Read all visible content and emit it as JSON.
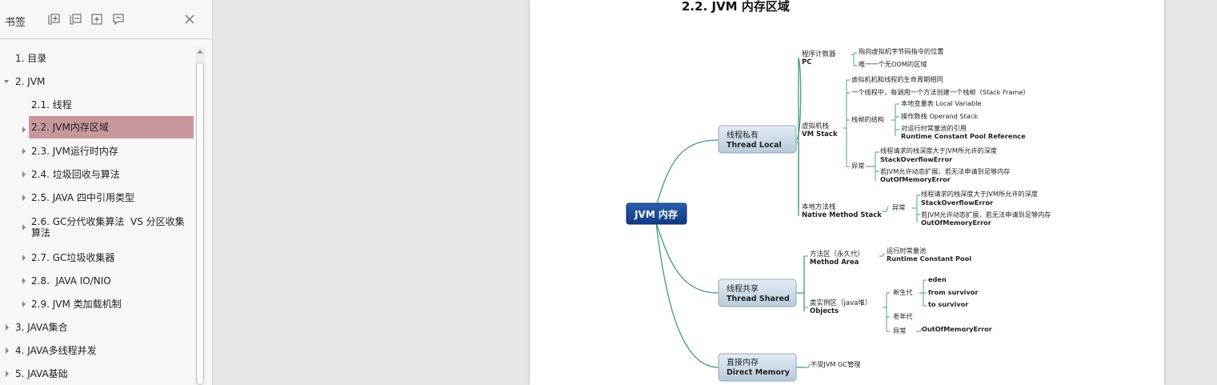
{
  "sidebar": {
    "title": "书签",
    "items": [
      {
        "label": "1. 目录"
      },
      {
        "label": "2. JVM"
      },
      {
        "label": "2.1. 线程"
      },
      {
        "label": "2.2. JVM内存区域"
      },
      {
        "label": "2.3. JVM运行时内存"
      },
      {
        "label": "2.4. 垃圾回收与算法"
      },
      {
        "label": "2.5. JAVA 四中引用类型"
      },
      {
        "label": "2.6. GC分代收集算法  VS 分区收集",
        "label2": "算法"
      },
      {
        "label": "2.7. GC垃圾收集器"
      },
      {
        "label": "2.8.  JAVA IO/NIO"
      },
      {
        "label": "2.9. JVM 类加载机制"
      },
      {
        "label": "3. JAVA集合"
      },
      {
        "label": "4. JAVA多线程并发"
      },
      {
        "label": "5. JAVA基础"
      }
    ]
  },
  "page": {
    "heading": "2.2. JVM 内存区域"
  },
  "mindmap": {
    "root": "JVM 内存",
    "b1": {
      "cn": "线程私有",
      "en": "Thread Local"
    },
    "b2": {
      "cn": "线程共享",
      "en": "Thread Shared"
    },
    "b3": {
      "cn": "直接内存",
      "en": "Direct Memory"
    },
    "pc": {
      "cn": "程序计数器",
      "en": "PC",
      "c1": "指向虚拟机字节码指令的位置",
      "c2": "唯一一个无OOM的区域"
    },
    "vms": {
      "cn": "虚拟机栈",
      "en": "VM Stack",
      "c1": "虚拟机机和线程的生命周期相同",
      "c2": "一个线程中，每调用一个方法创建一个栈帧（Stack Frame）",
      "frame": "栈帧的结构",
      "f1": "本地变量表 Local Variable",
      "f2": "操作数栈 Operand Stack",
      "f3a": "对运行时常量池的引用",
      "f3b": "Runtime Constant Pool Reference",
      "ex": "异常",
      "e1a": "线程请求的栈深度大于JVM所允许的深度",
      "e1b": "StackOverflowError",
      "e2a": "若JVM允许动态扩展，若无法申请到足够内存",
      "e2b": "OutOfMemoryError"
    },
    "nms": {
      "cn": "本地方法栈",
      "en": "Native Method Stack",
      "ex": "异常",
      "e1a": "线程请求的栈深度大于JVM所允许的深度",
      "e1b": "StackOverflowError",
      "e2a": "若JVM允许动态扩展，若无法申请到足够内存",
      "e2b": "OutOfMemoryError"
    },
    "ma": {
      "cn": "方法区（永久代）",
      "en": "Method Area",
      "c1a": "运行时常量池",
      "c1b": "Runtime Constant Pool"
    },
    "obj": {
      "cn": "类实例区（java堆）",
      "en": "Objects",
      "young": "新生代",
      "y1": "eden",
      "y2": "from survivor",
      "y3": "to survivor",
      "old": "老年代",
      "ex": "异常",
      "oom": "OutOfMemoryError"
    },
    "dm": {
      "c1": "不受JVM GC管理"
    }
  }
}
